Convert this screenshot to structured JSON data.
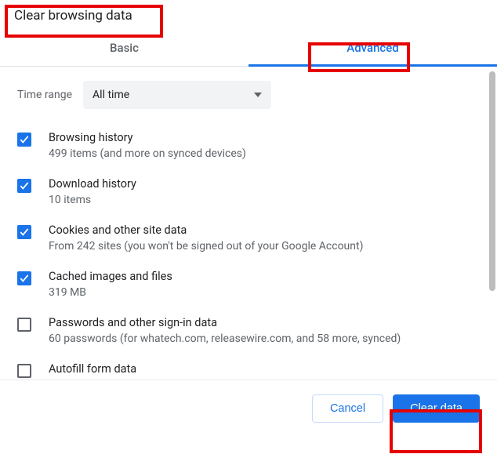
{
  "dialog": {
    "title": "Clear browsing data"
  },
  "tabs": {
    "basic": "Basic",
    "advanced": "Advanced"
  },
  "timeRange": {
    "label": "Time range",
    "value": "All time"
  },
  "items": [
    {
      "checked": true,
      "primary": "Browsing history",
      "secondary": "499 items (and more on synced devices)"
    },
    {
      "checked": true,
      "primary": "Download history",
      "secondary": "10 items"
    },
    {
      "checked": true,
      "primary": "Cookies and other site data",
      "secondary": "From 242 sites (you won't be signed out of your Google Account)"
    },
    {
      "checked": true,
      "primary": "Cached images and files",
      "secondary": "319 MB"
    },
    {
      "checked": false,
      "primary": "Passwords and other sign-in data",
      "secondary": "60 passwords (for whatech.com, releasewire.com, and 58 more, synced)"
    },
    {
      "checked": false,
      "primary": "Autofill form data",
      "secondary": ""
    }
  ],
  "footer": {
    "cancel": "Cancel",
    "confirm": "Clear data"
  }
}
